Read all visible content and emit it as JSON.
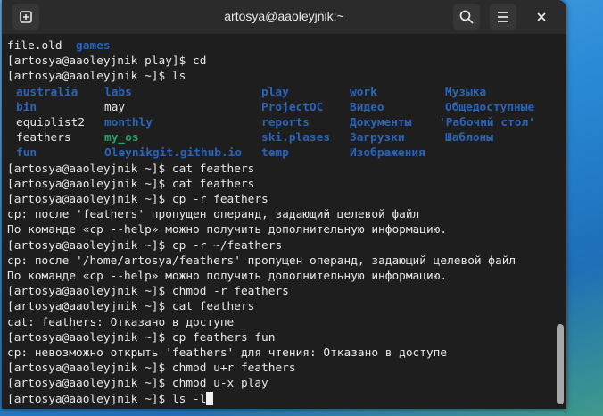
{
  "window": {
    "title": "artosya@aaoleyjnik:~"
  },
  "titlebar": {
    "new_tab_icon": "plus-square-icon",
    "search_icon": "search-icon",
    "menu_icon": "hamburger-menu-icon",
    "close_icon": "close-icon"
  },
  "colors": {
    "directory": "#2a64b8",
    "executable": "#26a269",
    "text": "#e8e8e8",
    "background": "#1e1e1e"
  },
  "terminal": {
    "top_lines": [
      {
        "parts": [
          {
            "t": "file.old  ",
            "k": ""
          },
          {
            "t": "games",
            "k": "dir"
          }
        ]
      },
      {
        "parts": [
          {
            "t": "[artosya@aaoleyjnik play]$ cd",
            "k": ""
          }
        ]
      },
      {
        "parts": [
          {
            "t": "[artosya@aaoleyjnik ~]$ ls",
            "k": ""
          }
        ]
      }
    ],
    "ls_rows": [
      [
        {
          "t": "australia",
          "k": "dir"
        },
        {
          "t": "labs",
          "k": "dir"
        },
        {
          "t": "play",
          "k": "dir"
        },
        {
          "t": "work",
          "k": "dir"
        },
        {
          "t": "Музыка",
          "k": "dir"
        }
      ],
      [
        {
          "t": "bin",
          "k": "dir"
        },
        {
          "t": "may",
          "k": ""
        },
        {
          "t": "ProjectOC",
          "k": "dir"
        },
        {
          "t": "Видео",
          "k": "dir"
        },
        {
          "t": "Общедоступные",
          "k": "dir"
        }
      ],
      [
        {
          "t": "equiplist2",
          "k": ""
        },
        {
          "t": "monthly",
          "k": "dir"
        },
        {
          "t": "reports",
          "k": "dir"
        },
        {
          "t": "Документы",
          "k": "dir"
        },
        {
          "t": "'Рабочий стол'",
          "k": "dir"
        }
      ],
      [
        {
          "t": "feathers",
          "k": ""
        },
        {
          "t": "my_os",
          "k": "exe"
        },
        {
          "t": "ski.plases",
          "k": "dir"
        },
        {
          "t": "Загрузки",
          "k": "dir"
        },
        {
          "t": "Шаблоны",
          "k": "dir"
        }
      ],
      [
        {
          "t": "fun",
          "k": "dir"
        },
        {
          "t": "Oleynikgit.github.io",
          "k": "dir"
        },
        {
          "t": "temp",
          "k": "dir"
        },
        {
          "t": "Изображения",
          "k": "dir"
        },
        {
          "t": "",
          "k": ""
        }
      ]
    ],
    "lines": [
      "[artosya@aaoleyjnik ~]$ cat feathers",
      "[artosya@aaoleyjnik ~]$ cat feathers",
      "[artosya@aaoleyjnik ~]$ cp -r feathers",
      "cp: после 'feathers' пропущен операнд, задающий целевой файл",
      "По команде «cp --help» можно получить дополнительную информацию.",
      "[artosya@aaoleyjnik ~]$ cp -r ~/feathers",
      "cp: после '/home/artosya/feathers' пропущен операнд, задающий целевой файл",
      "По команде «cp --help» можно получить дополнительную информацию.",
      "[artosya@aaoleyjnik ~]$ chmod -r feathers",
      "[artosya@aaoleyjnik ~]$ cat feathers",
      "cat: feathers: Отказано в доступе",
      "[artosya@aaoleyjnik ~]$ cp feathers fun",
      "cp: невозможно открыть 'feathers' для чтения: Отказано в доступе",
      "[artosya@aaoleyjnik ~]$ chmod u+r feathers",
      "[artosya@aaoleyjnik ~]$ chmod u-x play"
    ],
    "prompt_line": "[artosya@aaoleyjnik ~]$ ls -l"
  }
}
